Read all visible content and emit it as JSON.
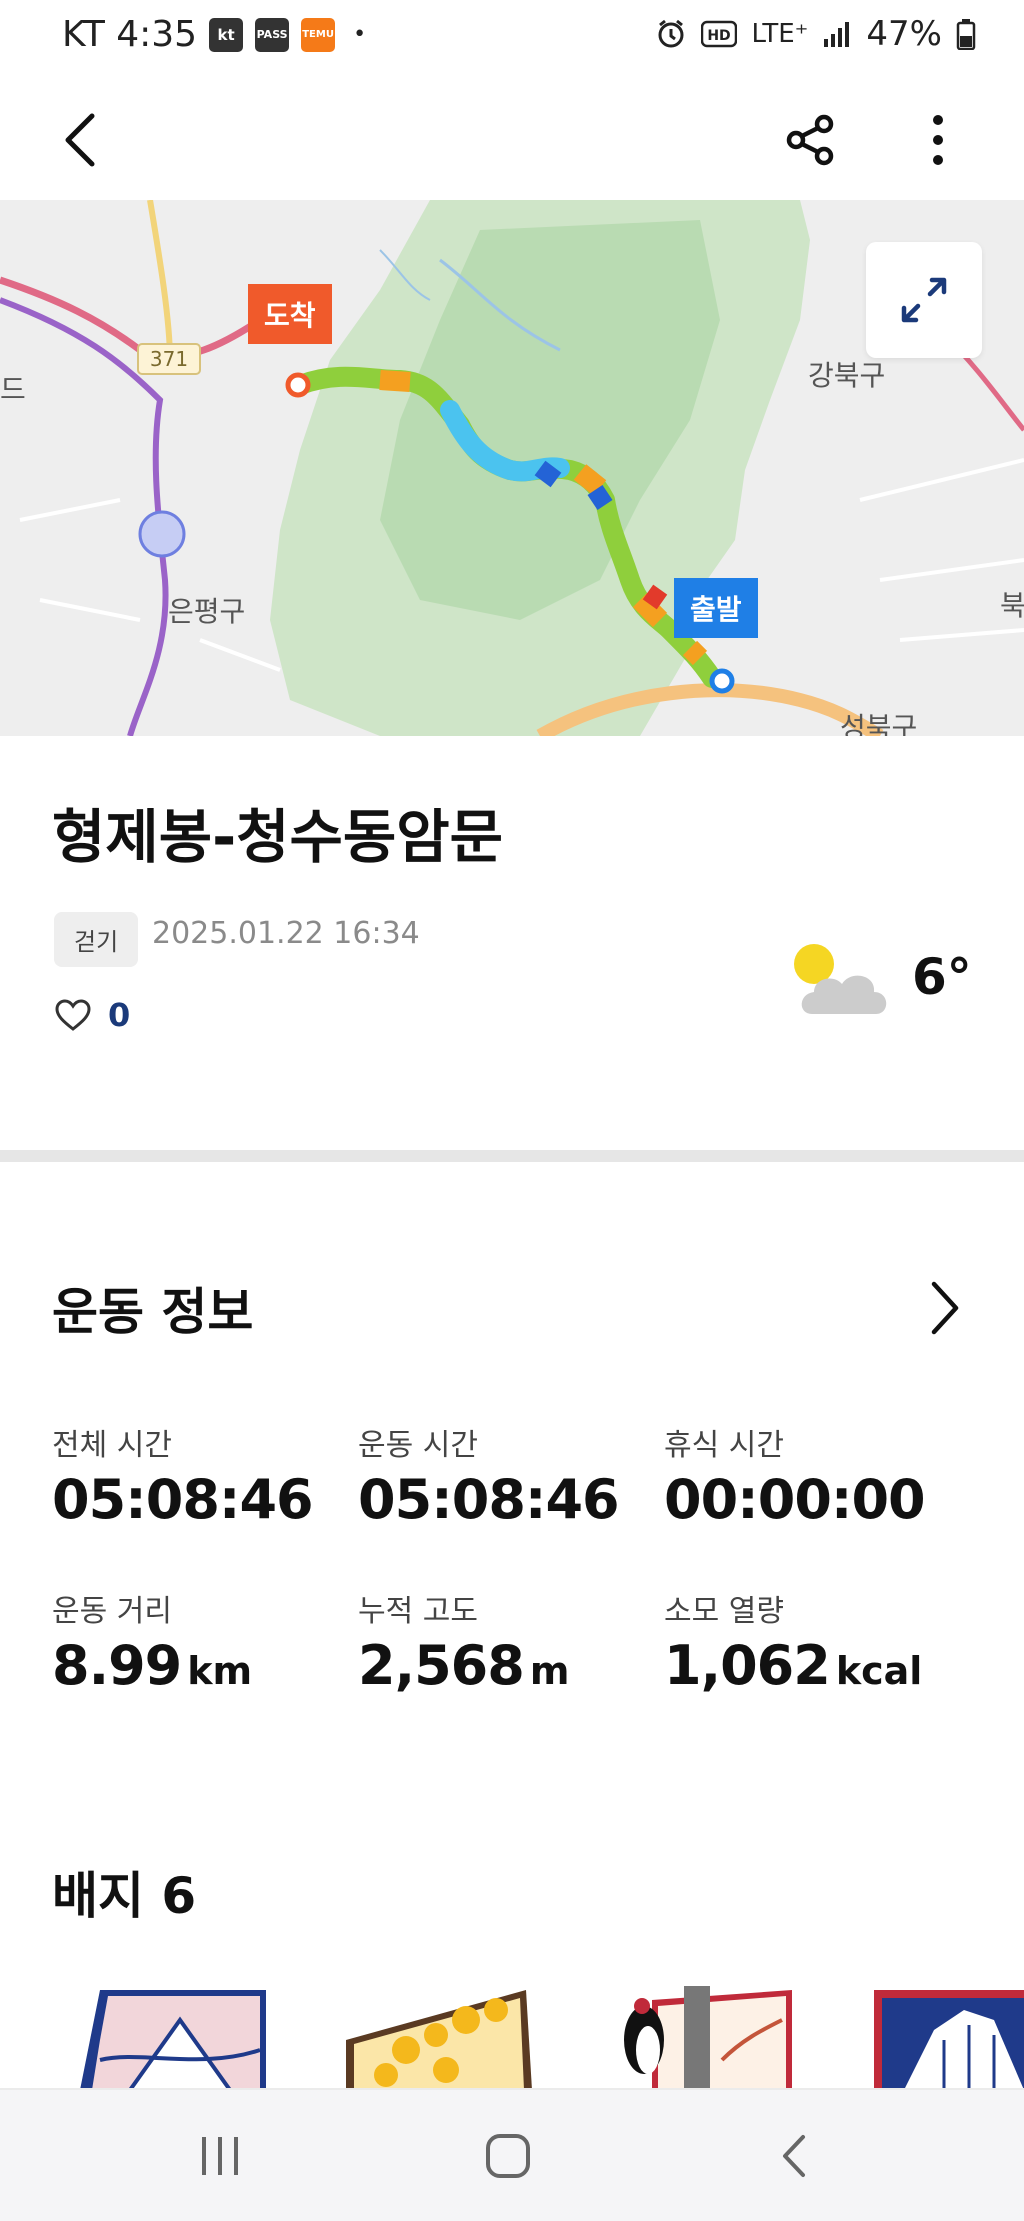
{
  "status_bar": {
    "carrier_time": "KT 4:35",
    "icons": [
      "kt-icon",
      "pass-icon",
      "temu-icon"
    ],
    "kt_label": "kt",
    "pass_label": "PASS",
    "temu_label": "TEMU",
    "dot": "•",
    "network": "LTE⁺",
    "battery": "47%"
  },
  "toolbar": {
    "back": "back-arrow-icon",
    "share": "share-icon",
    "more": "more-vert-icon"
  },
  "map": {
    "end_marker": "도착",
    "start_marker": "출발",
    "road_number": "371",
    "labels": {
      "gangbuk": "강북구",
      "eunpyeong": "은평구",
      "buk": "북",
      "seobuk": "성북구",
      "do": "드"
    }
  },
  "activity": {
    "title": "형제봉-청수동암문",
    "type_tag": "걷기",
    "datetime": "2025.01.22 16:34",
    "likes": "0",
    "weather_icon": "partly-cloudy-icon",
    "temperature": "6°"
  },
  "exercise_info": {
    "section_title": "운동 정보",
    "stats": [
      {
        "label": "전체 시간",
        "value": "05:08:46",
        "unit": ""
      },
      {
        "label": "운동 시간",
        "value": "05:08:46",
        "unit": ""
      },
      {
        "label": "휴식 시간",
        "value": "00:00:00",
        "unit": ""
      },
      {
        "label": "운동 거리",
        "value": "8.99",
        "unit": "km"
      },
      {
        "label": "누적 고도",
        "value": "2,568",
        "unit": "m"
      },
      {
        "label": "소모 열량",
        "value": "1,062",
        "unit": "kcal"
      }
    ]
  },
  "badges": {
    "section_title": "배지 6"
  },
  "colors": {
    "end_marker": "#f05a2b",
    "start_marker": "#1f7fe6",
    "route_green": "#8fcf3c",
    "route_blue": "#4bc3ef",
    "route_orange": "#f4a020"
  }
}
